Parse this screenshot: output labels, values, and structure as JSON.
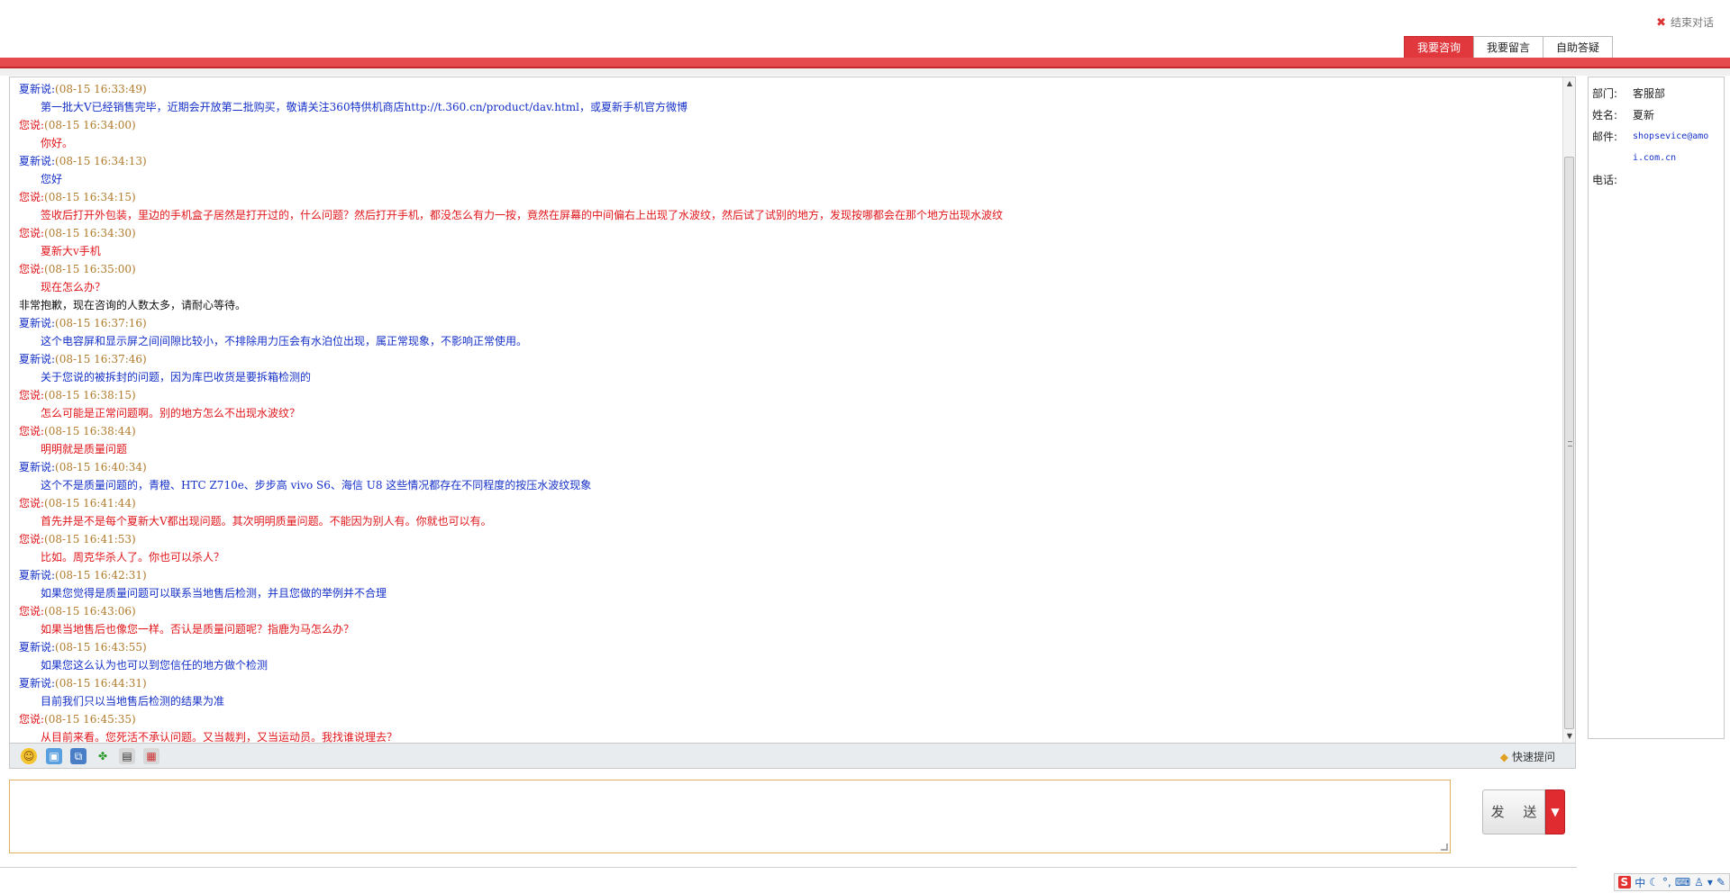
{
  "header": {
    "end_chat_label": "结束对话"
  },
  "tabs": [
    {
      "label": "我要咨询",
      "active": true
    },
    {
      "label": "我要留言",
      "active": false
    },
    {
      "label": "自助答疑",
      "active": false
    }
  ],
  "messages": [
    {
      "who": "夏新说:",
      "time": "(08-15 16:33:49)",
      "text": "第一批大V已经销售完毕，近期会开放第二批购买，敬请关注360特供机商店http://t.360.cn/product/dav.html，或夏新手机官方微博",
      "color": "blue"
    },
    {
      "who": "您说:",
      "time": "(08-15 16:34:00)",
      "text": "你好。",
      "color": "red"
    },
    {
      "who": "夏新说:",
      "time": "(08-15 16:34:13)",
      "text": "您好",
      "color": "blue"
    },
    {
      "who": "您说:",
      "time": "(08-15 16:34:15)",
      "text": "签收后打开外包装，里边的手机盒子居然是打开过的，什么问题？然后打开手机，都没怎么有力一按，竟然在屏幕的中间偏右上出现了水波纹，然后试了试别的地方，发现按哪都会在那个地方出现水波纹",
      "color": "red"
    },
    {
      "who": "您说:",
      "time": "(08-15 16:34:30)",
      "text": "夏新大v手机",
      "color": "red"
    },
    {
      "who": "您说:",
      "time": "(08-15 16:35:00)",
      "text": "现在怎么办？",
      "color": "red"
    },
    {
      "system": "非常抱歉，现在咨询的人数太多，请耐心等待。"
    },
    {
      "who": "夏新说:",
      "time": "(08-15 16:37:16)",
      "text": "这个电容屏和显示屏之间间隙比较小，不排除用力压会有水泊位出现，属正常现象，不影响正常使用。",
      "color": "blue"
    },
    {
      "who": "夏新说:",
      "time": "(08-15 16:37:46)",
      "text": "关于您说的被拆封的问题，因为库巴收货是要拆箱检测的",
      "color": "blue"
    },
    {
      "who": "您说:",
      "time": "(08-15 16:38:15)",
      "text": "怎么可能是正常问题啊。别的地方怎么不出现水波纹？",
      "color": "red"
    },
    {
      "who": "您说:",
      "time": "(08-15 16:38:44)",
      "text": "明明就是质量问题",
      "color": "red"
    },
    {
      "who": "夏新说:",
      "time": "(08-15 16:40:34)",
      "text": "这个不是质量问题的，青橙、HTC Z710e、步步高 vivo S6、海信 U8 这些情况都存在不同程度的按压水波纹现象",
      "color": "blue"
    },
    {
      "who": "您说:",
      "time": "(08-15 16:41:44)",
      "text": "首先并是不是每个夏新大V都出现问题。其次明明质量问题。不能因为别人有。你就也可以有。",
      "color": "red"
    },
    {
      "who": "您说:",
      "time": "(08-15 16:41:53)",
      "text": "比如。周克华杀人了。你也可以杀人？",
      "color": "red"
    },
    {
      "who": "夏新说:",
      "time": "(08-15 16:42:31)",
      "text": "如果您觉得是质量问题可以联系当地售后检测，并且您做的举例并不合理",
      "color": "blue"
    },
    {
      "who": "您说:",
      "time": "(08-15 16:43:06)",
      "text": "如果当地售后也像您一样。否认是质量问题呢？指鹿为马怎么办？",
      "color": "red"
    },
    {
      "who": "夏新说:",
      "time": "(08-15 16:43:55)",
      "text": "如果您这么认为也可以到您信任的地方做个检测",
      "color": "blue"
    },
    {
      "who": "夏新说:",
      "time": "(08-15 16:44:31)",
      "text": "目前我们只以当地售后检测的结果为准",
      "color": "blue"
    },
    {
      "who": "您说:",
      "time": "(08-15 16:45:35)",
      "text": "从目前来看。您死活不承认问题。又当裁判，又当运动员。我找谁说理去？",
      "color": "red"
    }
  ],
  "toolbar": {
    "icons": [
      "smiley-icon",
      "image-icon",
      "screenshot-icon",
      "evaluate-icon",
      "file-icon",
      "save-icon"
    ],
    "quick_question_label": "快速提问"
  },
  "input": {
    "value": ""
  },
  "send": {
    "label": "发 送",
    "dropdown_symbol": "▼"
  },
  "info_panel": {
    "dept_label": "部门:",
    "dept_value": "客服部",
    "name_label": "姓名:",
    "name_value": "夏新",
    "email_label": "邮件:",
    "email_value": "shopsevice@amoi.com.cn",
    "phone_label": "电话:",
    "phone_value": ""
  },
  "ime": {
    "logo": "S",
    "mode": "中"
  },
  "colors": {
    "accent_red": "#e0383d",
    "message_blue": "#1530c8",
    "message_red": "#e0161b",
    "timestamp": "#b07a2a"
  }
}
